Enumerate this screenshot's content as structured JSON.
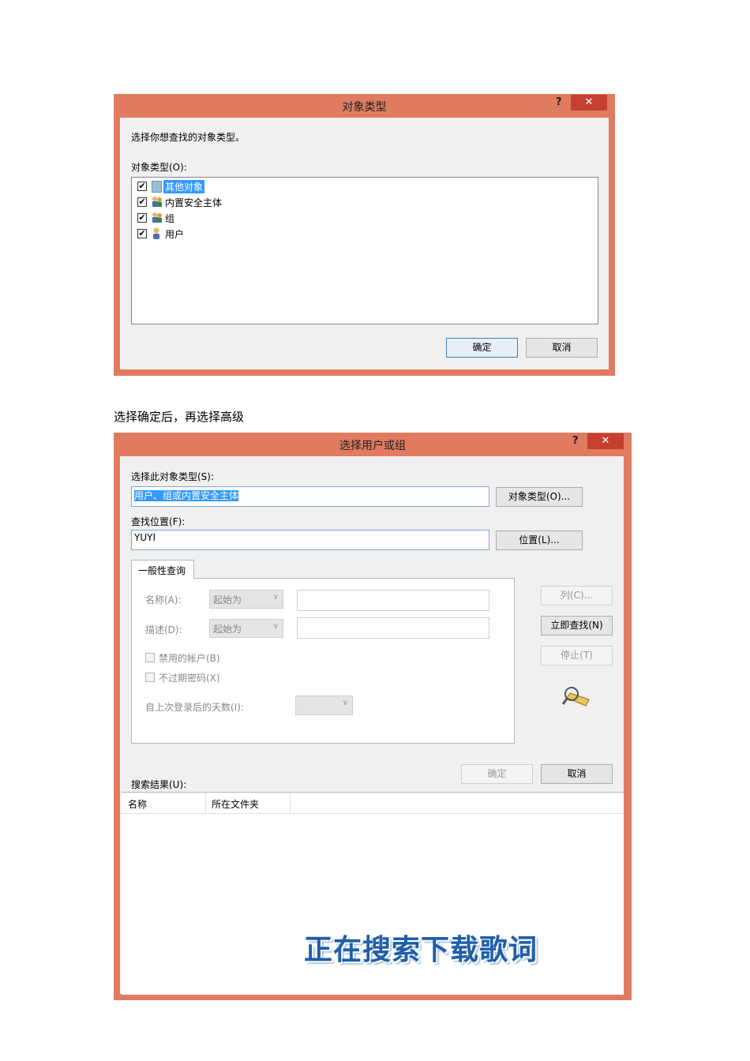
{
  "dialog1": {
    "title": "对象类型",
    "help": "?",
    "close": "✕",
    "prompt": "选择你想查找的对象类型。",
    "list_label": "对象类型(O):",
    "items": [
      {
        "label": "其他对象",
        "checked": true,
        "icon": "generic-object-icon"
      },
      {
        "label": "内置安全主体",
        "checked": true,
        "icon": "security-principal-icon"
      },
      {
        "label": "组",
        "checked": true,
        "icon": "group-icon"
      },
      {
        "label": "用户",
        "checked": true,
        "icon": "user-icon"
      }
    ],
    "ok": "确定",
    "cancel": "取消"
  },
  "caption": "选择确定后，再选择高级",
  "dialog2": {
    "title": "选择用户或组",
    "help": "?",
    "close": "✕",
    "object_type_label": "选择此对象类型(S):",
    "object_type_value": "用户、组或内置安全主体",
    "object_type_button": "对象类型(O)...",
    "location_label": "查找位置(F):",
    "location_value": "YUYI",
    "location_button": "位置(L)...",
    "tab": "一般性查询",
    "name_label": "名称(A):",
    "name_combo": "起始为",
    "desc_label": "描述(D):",
    "desc_combo": "起始为",
    "disabled_accounts": "禁用的帐户(B)",
    "nonexpiring_pw": "不过期密码(X)",
    "days_label": "自上次登录后的天数(I):",
    "columns_button": "列(C)...",
    "find_now_button": "立即查找(N)",
    "stop_button": "停止(T)",
    "ok": "确定",
    "cancel": "取消",
    "results_label": "搜索结果(U):",
    "columns": [
      "名称",
      "所在文件夹"
    ],
    "overlay_text": "正在搜索下载歌词"
  },
  "colors": {
    "frame": "#e07b60",
    "close_button": "#c5402f",
    "client": "#f0f0f0",
    "selection": "#3399ff",
    "overlay_text": "#1f5fa8"
  }
}
